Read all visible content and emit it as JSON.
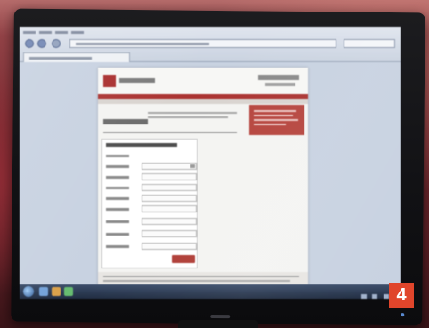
{
  "photo": {
    "subject": "monitor-displaying-web-form"
  },
  "overlay": {
    "step_badge": "4",
    "badge_color": "#e0452b"
  },
  "colors": {
    "site_accent": "#b5302e",
    "promo_box": "#c0423b",
    "submit_button": "#b93a33",
    "background": "#6e2a2e"
  },
  "icons": {
    "start": "start-orb-icon",
    "back": "back-arrow-icon",
    "forward": "forward-arrow-icon"
  }
}
